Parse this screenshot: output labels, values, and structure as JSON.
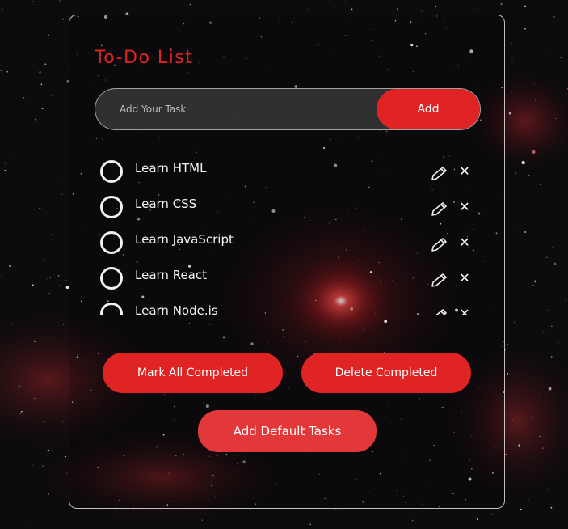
{
  "app": {
    "title": "To-Do List"
  },
  "input": {
    "placeholder": "Add Your Task",
    "value": "",
    "add_label": "Add"
  },
  "tasks": [
    {
      "label": "Learn HTML",
      "completed": false
    },
    {
      "label": "Learn CSS",
      "completed": false
    },
    {
      "label": "Learn JavaScript",
      "completed": false
    },
    {
      "label": "Learn React",
      "completed": false
    },
    {
      "label": "Learn Node.js",
      "completed": false
    }
  ],
  "icons": {
    "edit": "pencil-icon",
    "delete": "close-icon"
  },
  "actions": {
    "mark_all_label": "Mark All Completed",
    "delete_completed_label": "Delete Completed",
    "add_default_label": "Add Default Tasks"
  },
  "colors": {
    "accent": "#e02424",
    "accent_light": "#e3383a",
    "text": "#f4f4f4"
  }
}
